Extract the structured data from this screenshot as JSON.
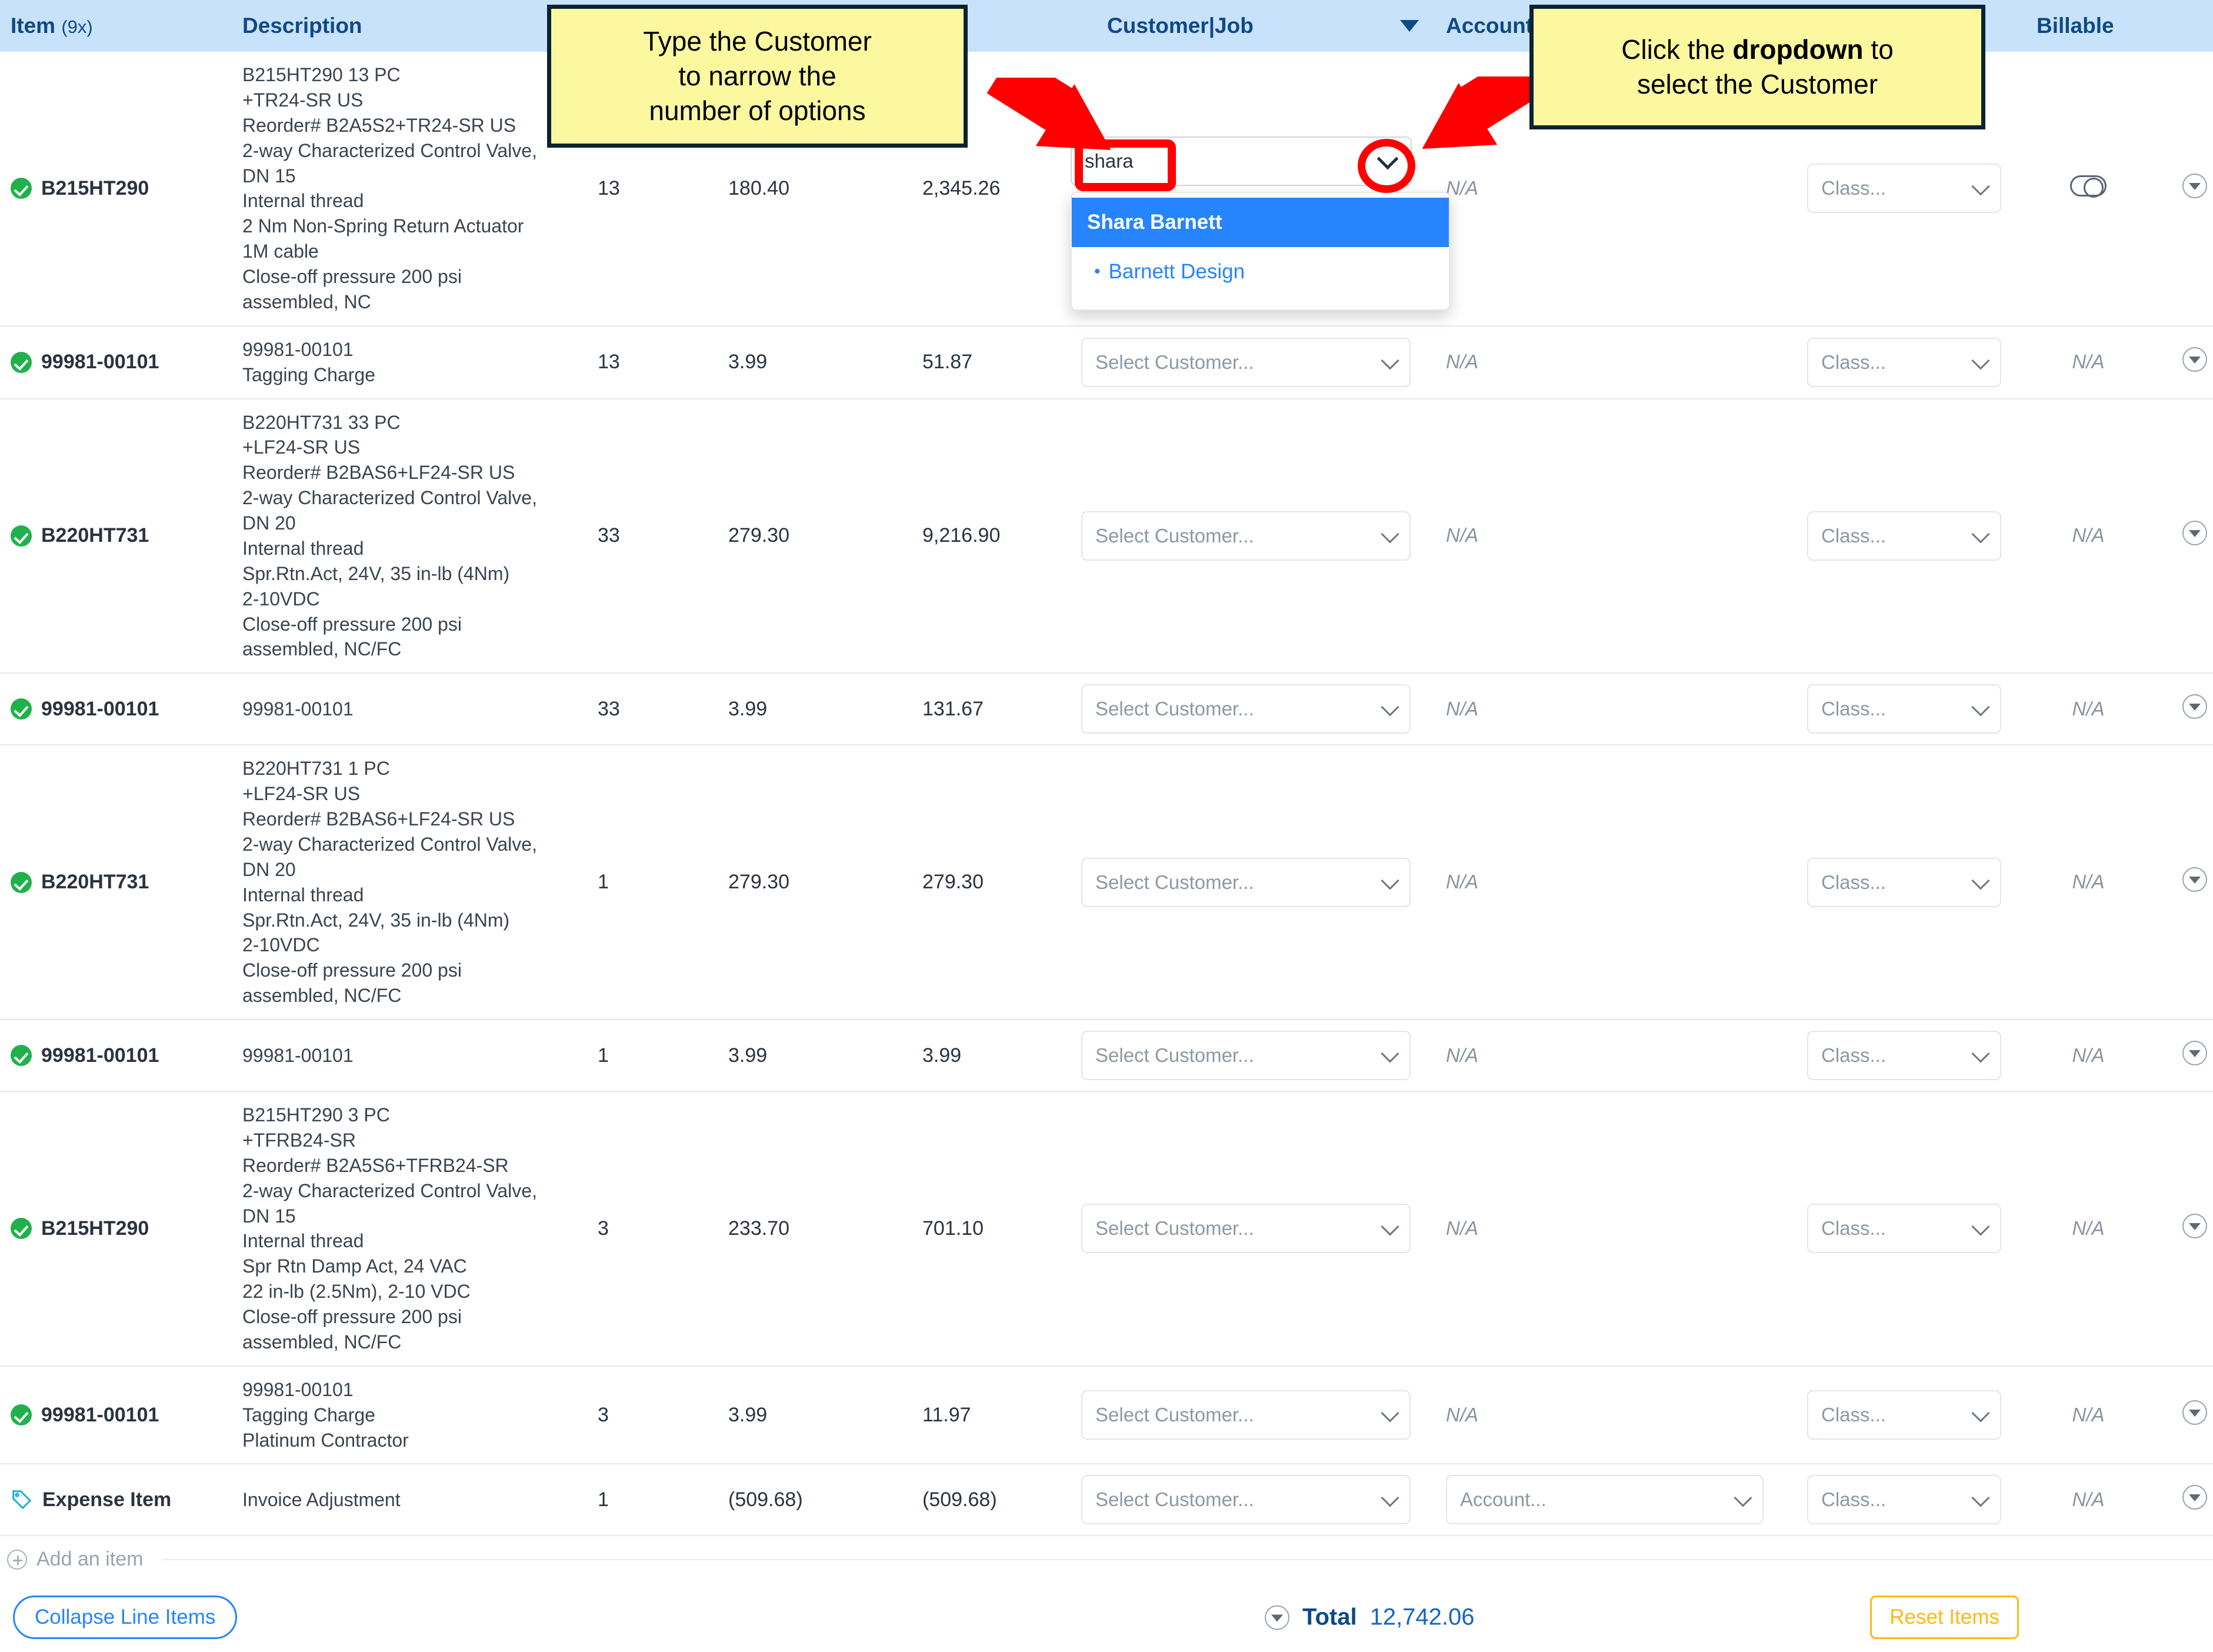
{
  "table": {
    "headers": {
      "item": "Item",
      "item_count": "(9x)",
      "description": "Description",
      "qty": "",
      "rate": "",
      "amount": "",
      "customer_job": "Customer|Job",
      "account": "Account",
      "class": "",
      "billable": "Billable"
    },
    "rows": [
      {
        "item": "B215HT290",
        "icon": "green-check-icon",
        "description": "B215HT290 13 PC\n+TR24-SR US\nReorder# B2A5S2+TR24-SR US\n2-way Characterized Control Valve,\nDN 15\nInternal thread\n2 Nm Non-Spring Return Actuator\n1M cable\nClose-off pressure 200 psi\nassembled, NC",
        "qty": "13",
        "rate": "180.40",
        "amount": "2,345.26",
        "customer": "",
        "account": "N/A",
        "class": "Class...",
        "billable": "toggle"
      },
      {
        "item": "99981-00101",
        "icon": "green-check-icon",
        "description": "99981-00101\nTagging Charge",
        "qty": "13",
        "rate": "3.99",
        "amount": "51.87",
        "customer": "Select Customer...",
        "account": "N/A",
        "class": "Class...",
        "billable": "N/A"
      },
      {
        "item": "B220HT731",
        "icon": "green-check-icon",
        "description": "B220HT731 33 PC\n+LF24-SR US\nReorder# B2BAS6+LF24-SR US\n2-way Characterized Control Valve,\nDN 20\nInternal thread\nSpr.Rtn.Act, 24V, 35 in-lb (4Nm)\n2-10VDC\nClose-off pressure 200 psi\nassembled, NC/FC",
        "qty": "33",
        "rate": "279.30",
        "amount": "9,216.90",
        "customer": "Select Customer...",
        "account": "N/A",
        "class": "Class...",
        "billable": "N/A"
      },
      {
        "item": "99981-00101",
        "icon": "green-check-icon",
        "description": "99981-00101",
        "qty": "33",
        "rate": "3.99",
        "amount": "131.67",
        "customer": "Select Customer...",
        "account": "N/A",
        "class": "Class...",
        "billable": "N/A"
      },
      {
        "item": "B220HT731",
        "icon": "green-check-icon",
        "description": "B220HT731 1 PC\n+LF24-SR US\nReorder# B2BAS6+LF24-SR US\n2-way Characterized Control Valve,\nDN 20\nInternal thread\nSpr.Rtn.Act, 24V, 35 in-lb (4Nm)\n2-10VDC\nClose-off pressure 200 psi\nassembled, NC/FC",
        "qty": "1",
        "rate": "279.30",
        "amount": "279.30",
        "customer": "Select Customer...",
        "account": "N/A",
        "class": "Class...",
        "billable": "N/A"
      },
      {
        "item": "99981-00101",
        "icon": "green-check-icon",
        "description": "99981-00101",
        "qty": "1",
        "rate": "3.99",
        "amount": "3.99",
        "customer": "Select Customer...",
        "account": "N/A",
        "class": "Class...",
        "billable": "N/A"
      },
      {
        "item": "B215HT290",
        "icon": "green-check-icon",
        "description": "B215HT290 3 PC\n+TFRB24-SR\nReorder# B2A5S6+TFRB24-SR\n2-way Characterized Control Valve,\nDN 15\nInternal thread\nSpr Rtn Damp Act, 24 VAC\n22 in-lb (2.5Nm), 2-10 VDC\nClose-off pressure 200 psi\nassembled, NC/FC",
        "qty": "3",
        "rate": "233.70",
        "amount": "701.10",
        "customer": "Select Customer...",
        "account": "N/A",
        "class": "Class...",
        "billable": "N/A"
      },
      {
        "item": "99981-00101",
        "icon": "green-check-icon",
        "description": "99981-00101\nTagging Charge\nPlatinum Contractor",
        "qty": "3",
        "rate": "3.99",
        "amount": "11.97",
        "customer": "Select Customer...",
        "account": "N/A",
        "class": "Class...",
        "billable": "N/A"
      },
      {
        "item": "Expense Item",
        "icon": "tag-icon",
        "description": "Invoice Adjustment",
        "qty": "1",
        "rate": "(509.68)",
        "amount": "(509.68)",
        "customer": "Select Customer...",
        "account": "Account...",
        "class": "Class...",
        "billable": "N/A"
      }
    ]
  },
  "active_combo": {
    "value": "shara",
    "options": [
      {
        "label": "Shara Barnett",
        "type": "customer",
        "selected": true
      },
      {
        "label": "Barnett Design",
        "type": "job",
        "bullet": "•",
        "selected": false
      }
    ]
  },
  "callouts": [
    {
      "text_line1": "Type the Customer",
      "text_line2": "to narrow the",
      "text_line3": "number of options"
    },
    {
      "pre": "Click the ",
      "bold": "dropdown",
      "post": " to",
      "text_line2": "select the Customer"
    }
  ],
  "footer": {
    "add_item": "Add an item",
    "collapse_button": "Collapse Line Items",
    "total_label": "Total",
    "total_value": "12,742.06",
    "reset_button": "Reset Items"
  },
  "colors": {
    "header_bg": "#c9e2fb",
    "header_text": "#0d4a86",
    "highlight": "#2684ff",
    "accent_yellow": "#fdb913",
    "callout_bg": "#fbf8a0",
    "annotation_red": "#ff0000",
    "check_green": "#20b14c"
  }
}
